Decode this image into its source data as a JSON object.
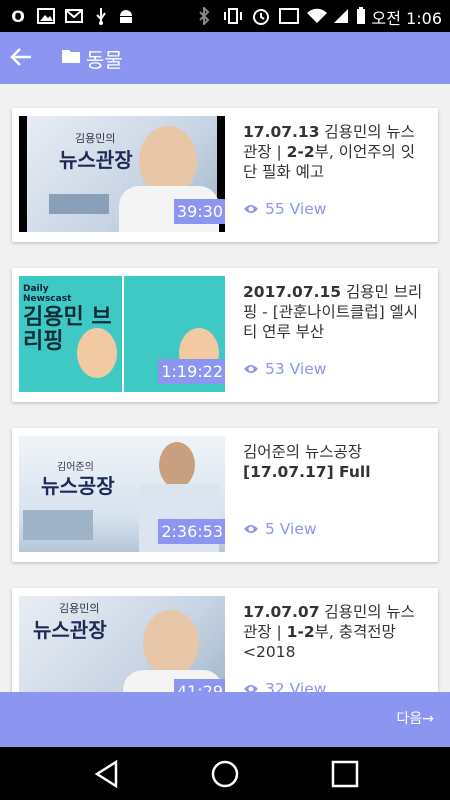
{
  "status": {
    "carrier_badge": "O",
    "ampm": "오전",
    "time": "1:06"
  },
  "appbar": {
    "title": "동물"
  },
  "videos": [
    {
      "title_bold": "17.07.13",
      "title_rest": " 김용민의 뉴스관장 | ",
      "title_bold2": "2-2",
      "title_rest2": "부, 이언주의 잇단 필화 예고",
      "views": "55 View",
      "duration": "39:30",
      "thumb_text": "뉴스관장",
      "thumb_sub": "김용민의"
    },
    {
      "title_bold": "2017.07.15",
      "title_rest": " 김용민 브리핑 - [관훈나이트클럽] 엘시티 연루 부산",
      "title_bold2": "",
      "title_rest2": "",
      "views": "53 View",
      "duration": "1:19:22",
      "thumb_text": "김용민 브리핑",
      "thumb_sub": "Daily Newscast"
    },
    {
      "title_bold": "",
      "title_rest": "김어준의 뉴스공장 ",
      "title_bold2": "[17.07.17] Full",
      "title_rest2": "",
      "views": "5 View",
      "duration": "2:36:53",
      "thumb_text": "뉴스공장",
      "thumb_sub": "김어준의"
    },
    {
      "title_bold": "17.07.07",
      "title_rest": " 김용민의 뉴스관장 | ",
      "title_bold2": "1-2",
      "title_rest2": "부, 충격전망 <2018",
      "views": "32 View",
      "duration": "41:29",
      "thumb_text": "뉴스관장",
      "thumb_sub": "김용민의"
    }
  ],
  "footer": {
    "next_label": "다음→"
  },
  "colors": {
    "accent": "#8c96f0",
    "statusbar": "#000000"
  }
}
